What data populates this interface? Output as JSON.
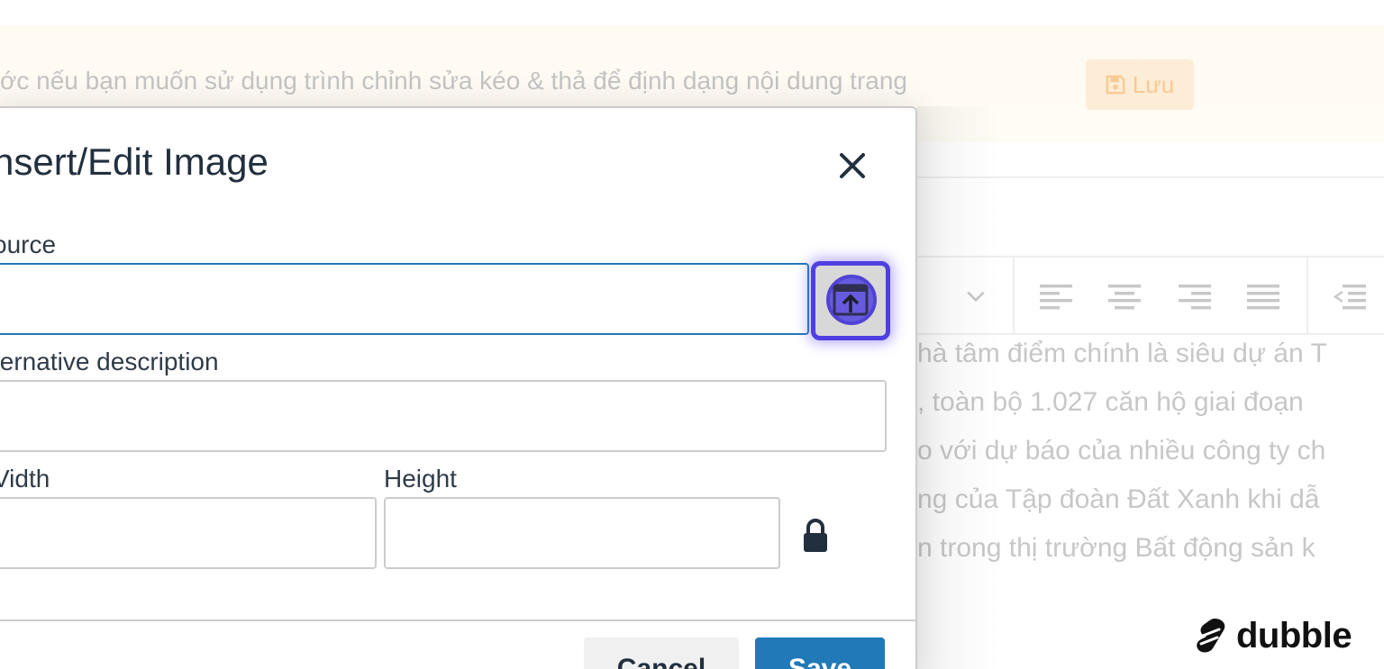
{
  "background": {
    "notice_text": "ớc nếu bạn muốn sử dụng trình chỉnh sửa kéo & thả để định dạng nội dung trang",
    "notice_save_label": "Lưu",
    "content_lines": [
      "hà tâm điểm chính là siêu dự án T",
      ", toàn bộ 1.027 căn hộ giai đoạn",
      "o với dự báo của nhiều công ty ch",
      "ng của Tập đoàn Đất Xanh khi dẫ",
      "n trong thị trường Bất động sản k"
    ]
  },
  "dialog": {
    "title": "nsert/Edit Image",
    "source_label": "ource",
    "source_value": "",
    "alt_label": "ternative description",
    "alt_value": "",
    "width_label": "Vidth",
    "width_value": "",
    "height_label": "Height",
    "height_value": "",
    "cancel_label": "Cancel",
    "save_label": "Save"
  },
  "watermark": {
    "text": "dubble"
  },
  "colors": {
    "accent": "#207ab7",
    "focus_ring": "#4e3fe0",
    "notice_bg": "#fffaf1",
    "notice_button_bg": "#fdecd6"
  }
}
